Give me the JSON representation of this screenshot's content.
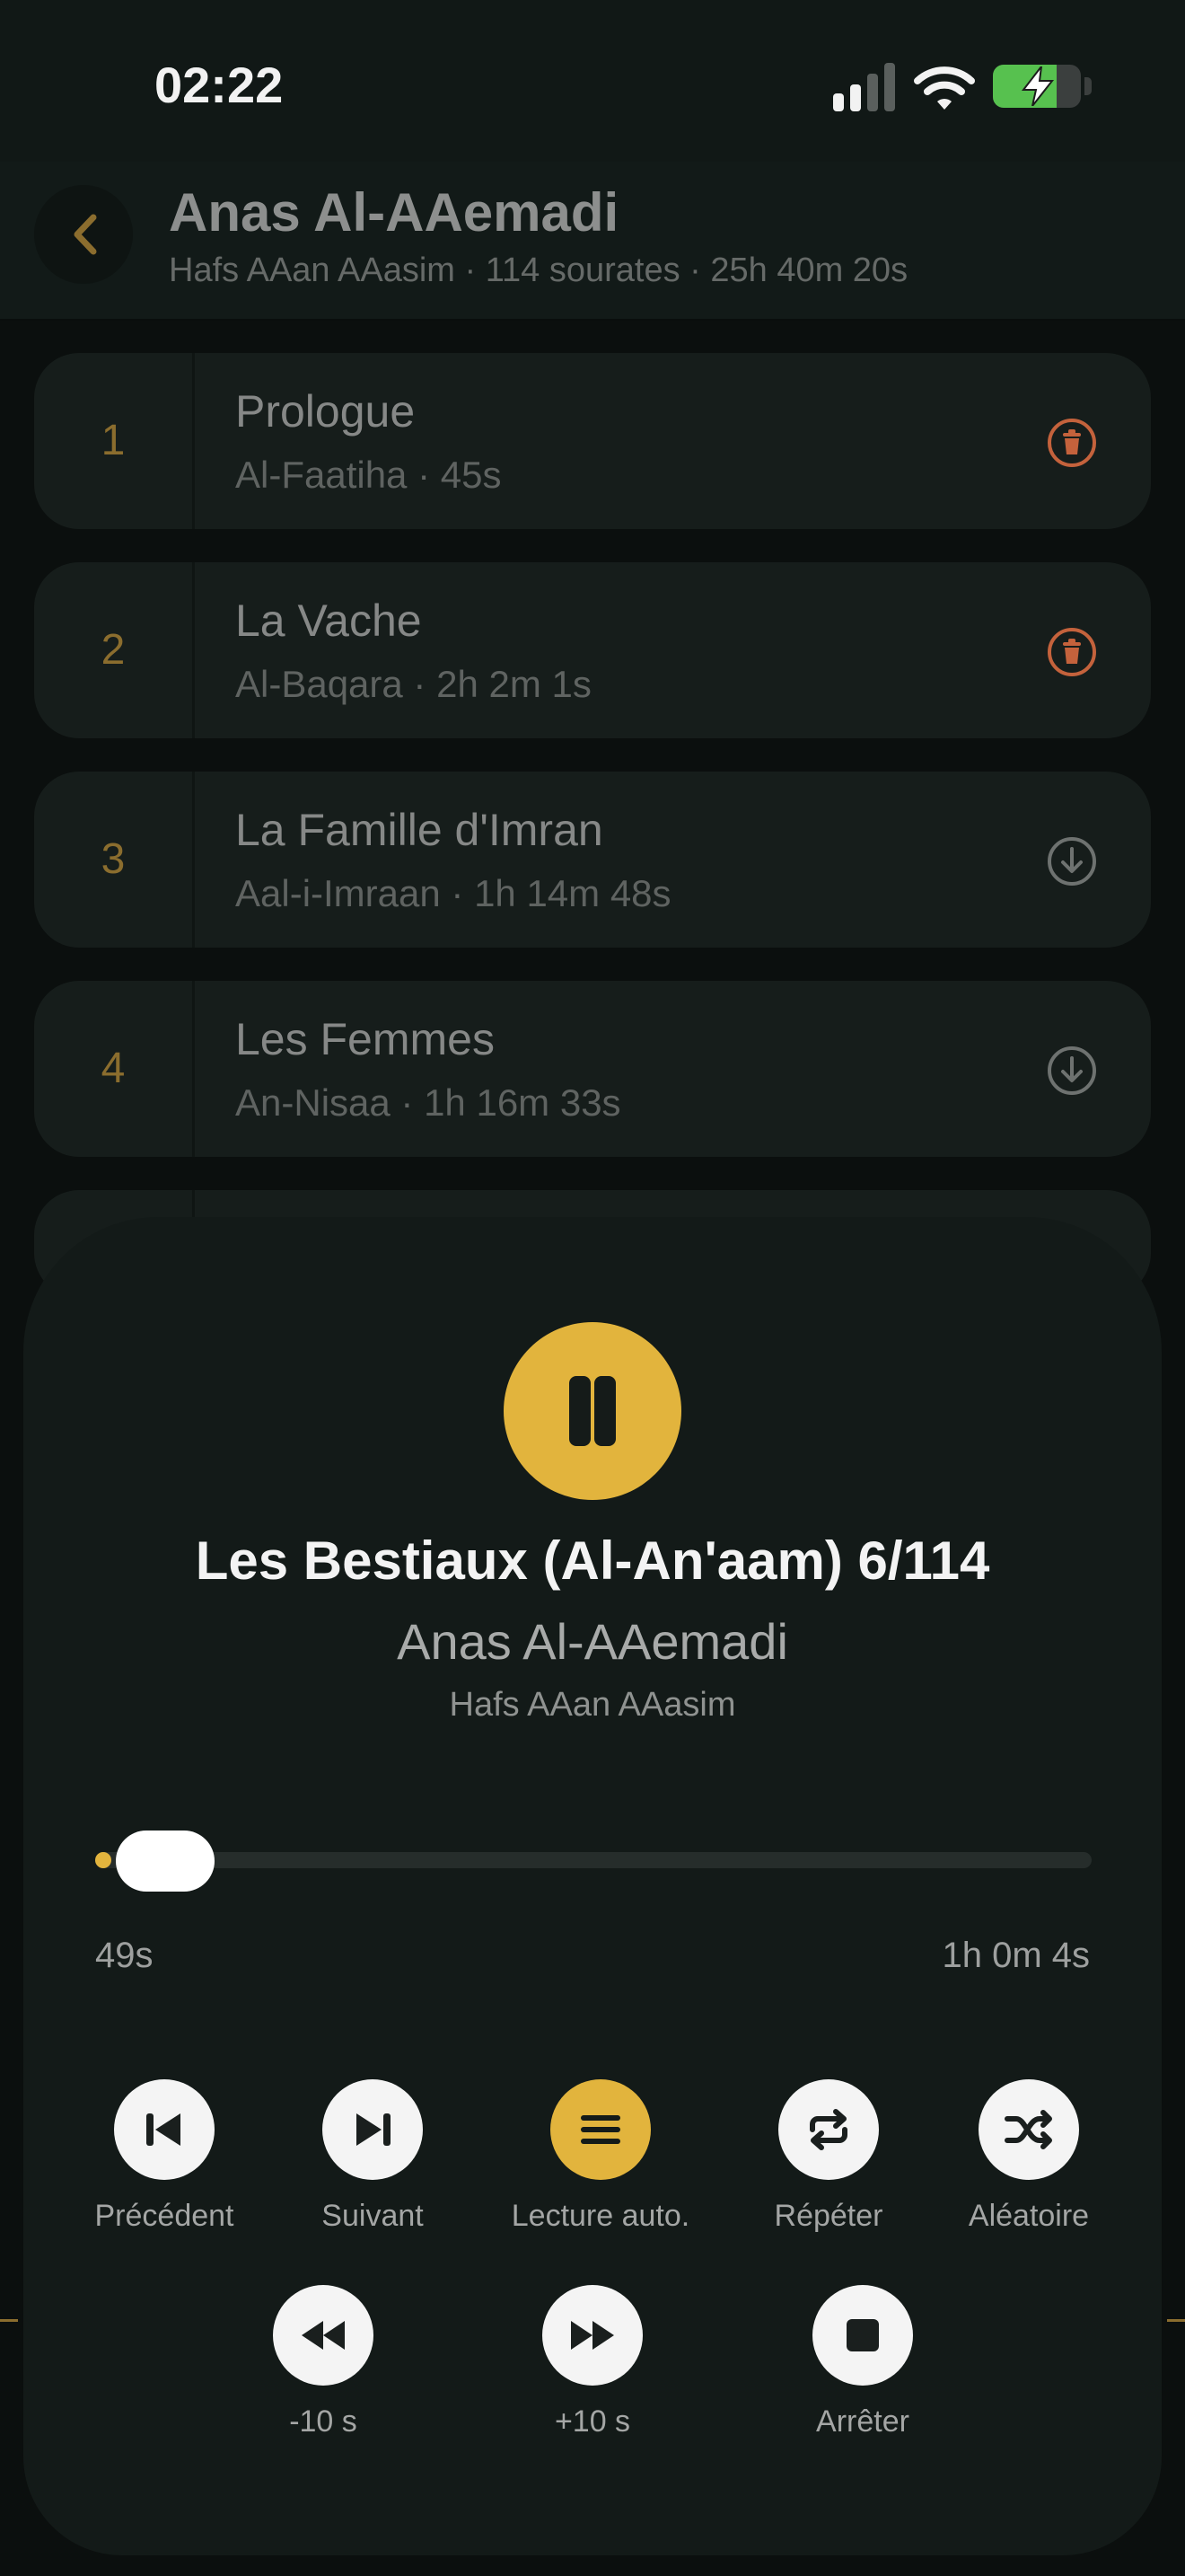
{
  "status_bar": {
    "time": "02:22",
    "icons": [
      "signal-icon",
      "wifi-icon",
      "battery-charging-icon"
    ],
    "battery_level": 0.72
  },
  "header": {
    "title": "Anas Al-AAemadi",
    "subtitle": "Hafs AAan AAasim · 114 sourates · 25h 40m 20s",
    "back_icon": "chevron-left-icon"
  },
  "surahs": [
    {
      "number": "1",
      "name": "Prologue",
      "transliteration": "Al-Faatiha",
      "duration": "45s",
      "action_icon": "trash-icon"
    },
    {
      "number": "2",
      "name": "La Vache",
      "transliteration": "Al-Baqara",
      "duration": "2h 2m 1s",
      "action_icon": "trash-icon"
    },
    {
      "number": "3",
      "name": "La Famille d'Imran",
      "transliteration": "Aal-i-Imraan",
      "duration": "1h 14m 48s",
      "action_icon": "download-icon"
    },
    {
      "number": "4",
      "name": "Les Femmes",
      "transliteration": "An-Nisaa",
      "duration": "1h 16m 33s",
      "action_icon": "download-icon"
    }
  ],
  "player": {
    "play_state_icon": "pause-icon",
    "title": "Les Bestiaux (Al-An'aam) 6/114",
    "reciter": "Anas Al-AAemadi",
    "riwaya": "Hafs AAan AAasim",
    "elapsed": "49s",
    "total": "1h 0m 4s",
    "progress": 0.0135,
    "controls_row1": [
      {
        "label": "Précédent",
        "icon": "skip-previous-icon",
        "active": false
      },
      {
        "label": "Suivant",
        "icon": "skip-next-icon",
        "active": false
      },
      {
        "label": "Lecture auto.",
        "icon": "list-icon",
        "active": true
      },
      {
        "label": "Répéter",
        "icon": "repeat-icon",
        "active": false
      },
      {
        "label": "Aléatoire",
        "icon": "shuffle-icon",
        "active": false
      }
    ],
    "controls_row2": [
      {
        "label": "-10 s",
        "icon": "rewind-icon"
      },
      {
        "label": "+10 s",
        "icon": "fast-forward-icon"
      },
      {
        "label": "Arrêter",
        "icon": "stop-icon"
      }
    ]
  },
  "colors": {
    "accent": "#e2b43d",
    "background": "#0b0f0e",
    "sheet": "#131a18",
    "delete": "#c4623c"
  }
}
